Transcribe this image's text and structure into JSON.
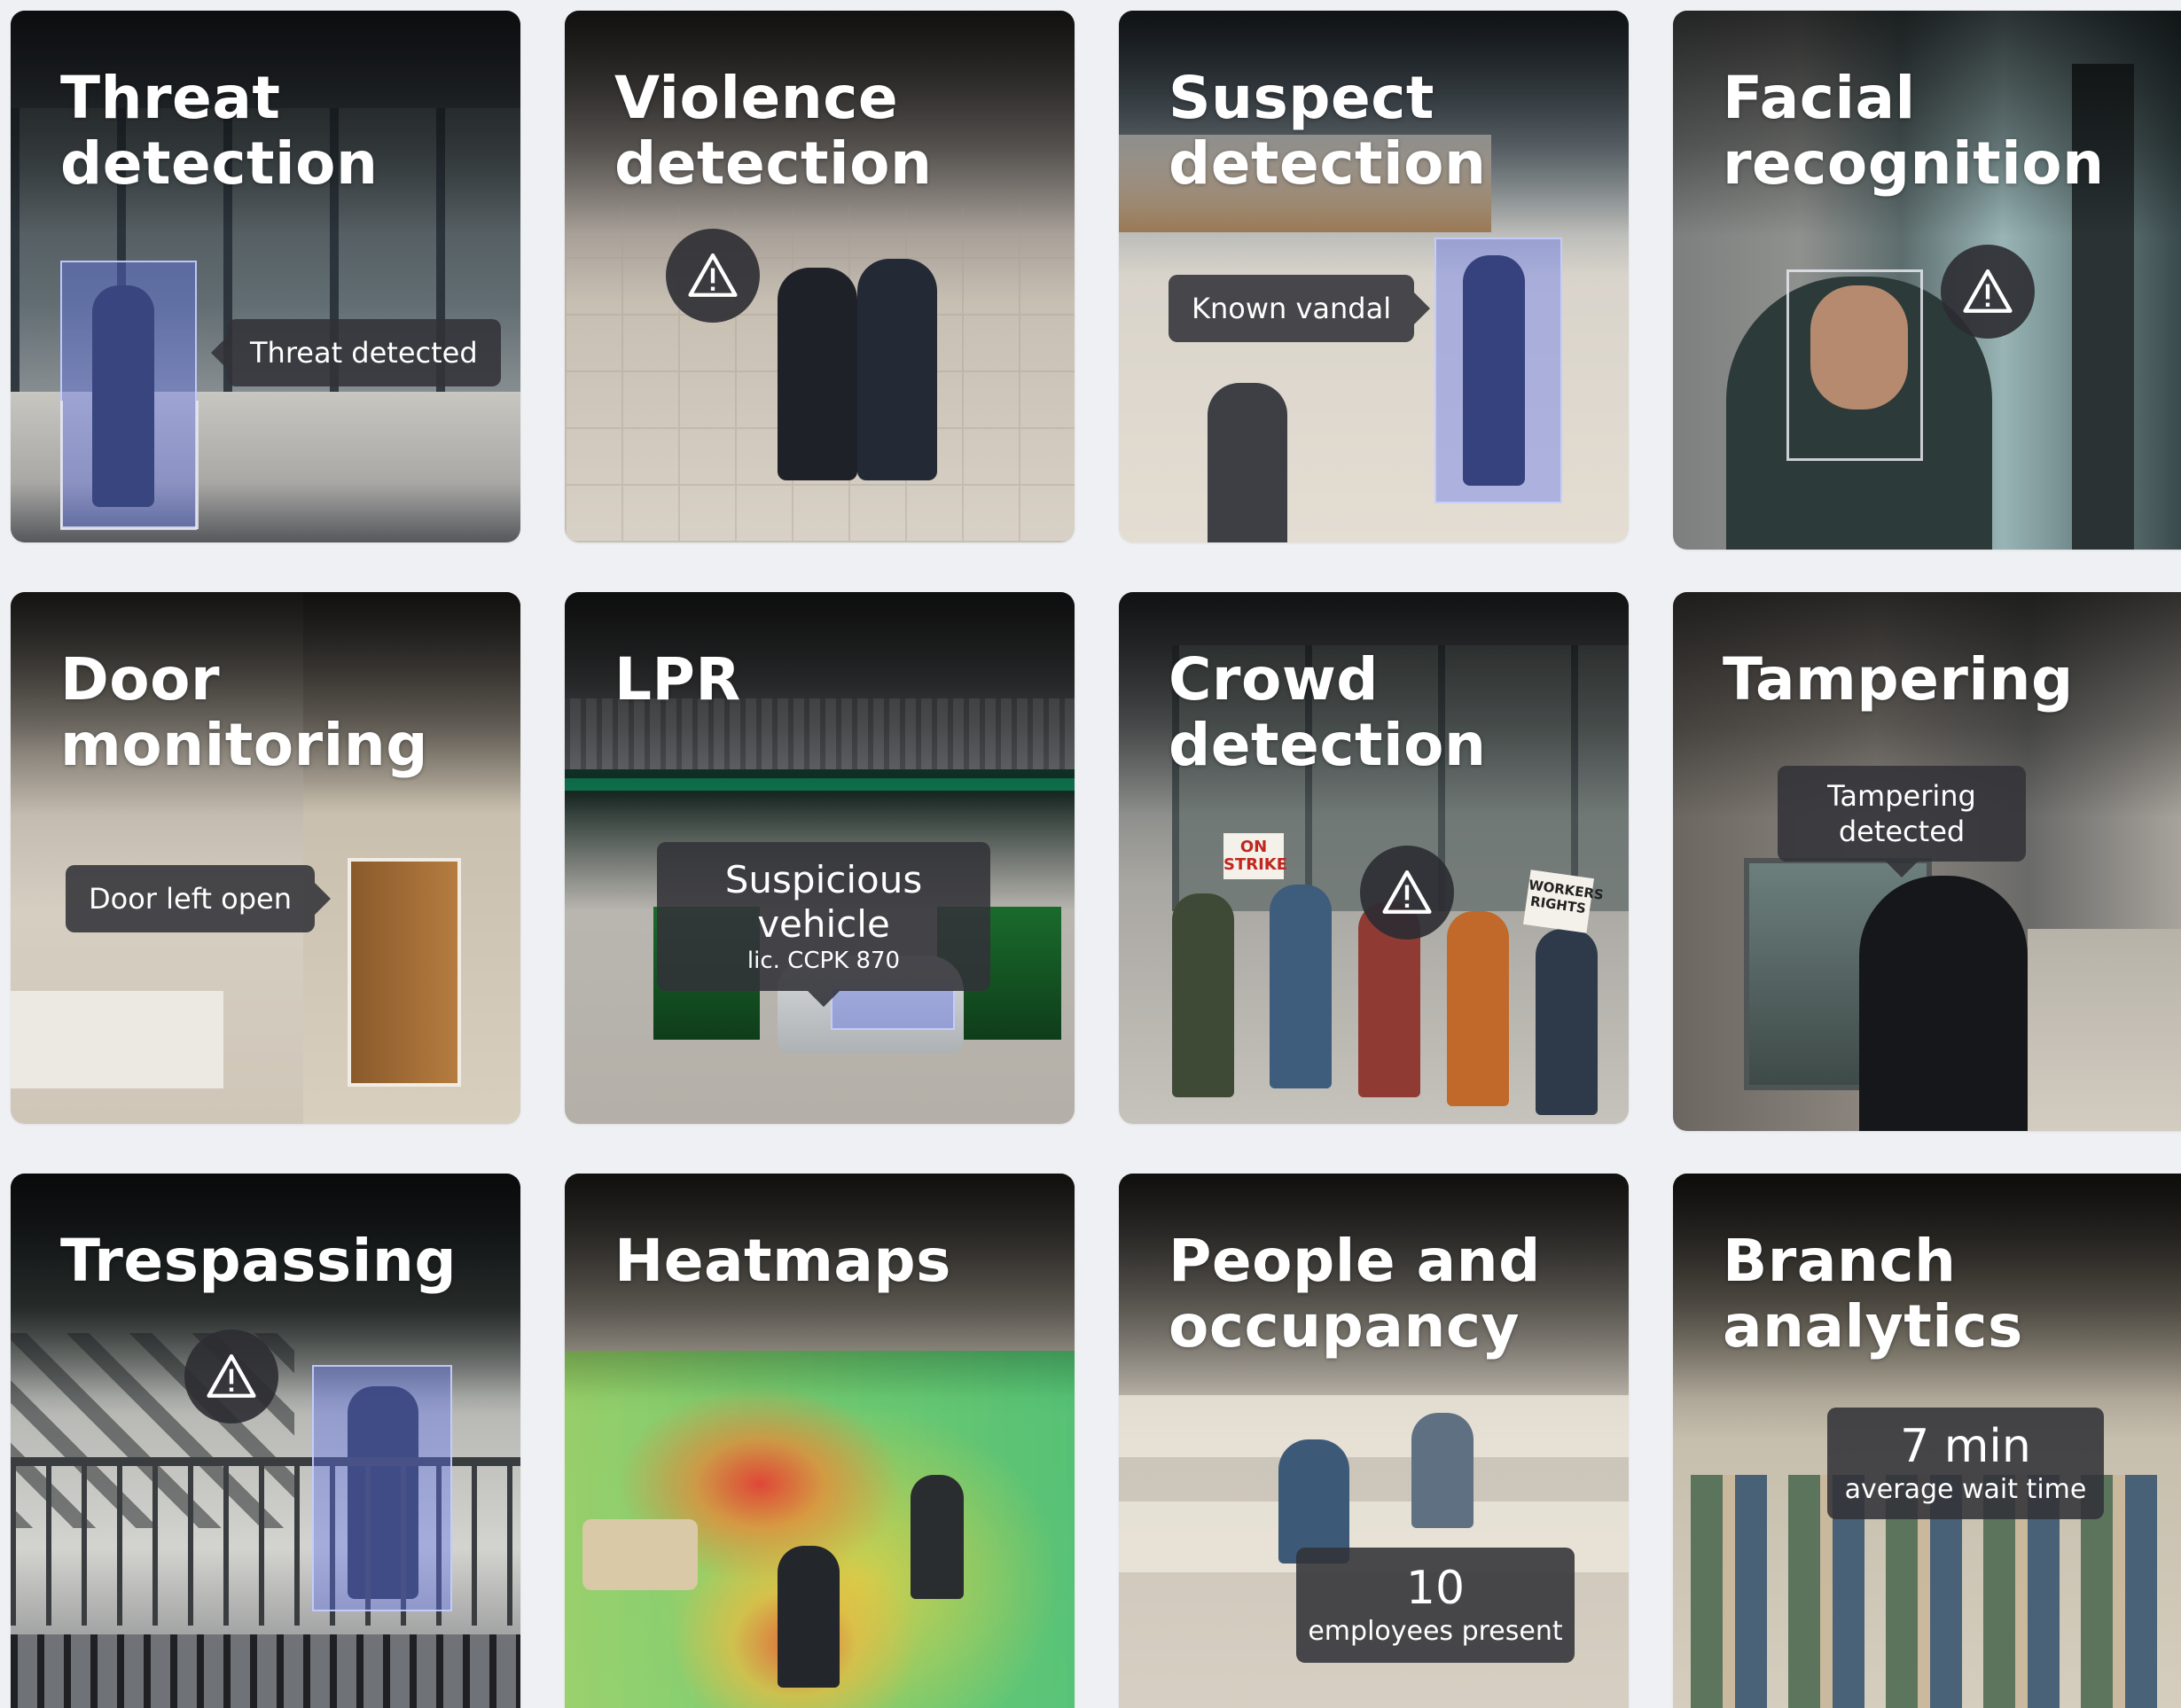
{
  "tiles": [
    {
      "title": "Threat\ndetection",
      "label": "Threat detected",
      "icon": "warning-icon"
    },
    {
      "title": "Violence\ndetection",
      "icon": "warning-icon"
    },
    {
      "title": "Suspect\ndetection",
      "label": "Known vandal"
    },
    {
      "title": "Facial\nrecognition",
      "icon": "warning-icon"
    },
    {
      "title": "Door\nmonitoring",
      "label": "Door left open"
    },
    {
      "title": "LPR",
      "label": "Suspicious vehicle",
      "sublabel": "lic. CCPK 870"
    },
    {
      "title": "Crowd\ndetection",
      "icon": "warning-icon",
      "signs": [
        "ON\nSTRIKE",
        "WORKERS\nRIGHTS"
      ]
    },
    {
      "title": "Tampering",
      "label": "Tampering\ndetected"
    },
    {
      "title": "Trespassing",
      "icon": "warning-icon"
    },
    {
      "title": "Heatmaps"
    },
    {
      "title": "People and\noccupancy",
      "value": "10",
      "sublabel": "employees present"
    },
    {
      "title": "Branch\nanalytics",
      "value": "7 min",
      "sublabel": "average wait time"
    }
  ],
  "colors": {
    "page_bg": "#eef0f3",
    "overlay_dark": "#323238",
    "detection_blue": "#6074f0"
  }
}
